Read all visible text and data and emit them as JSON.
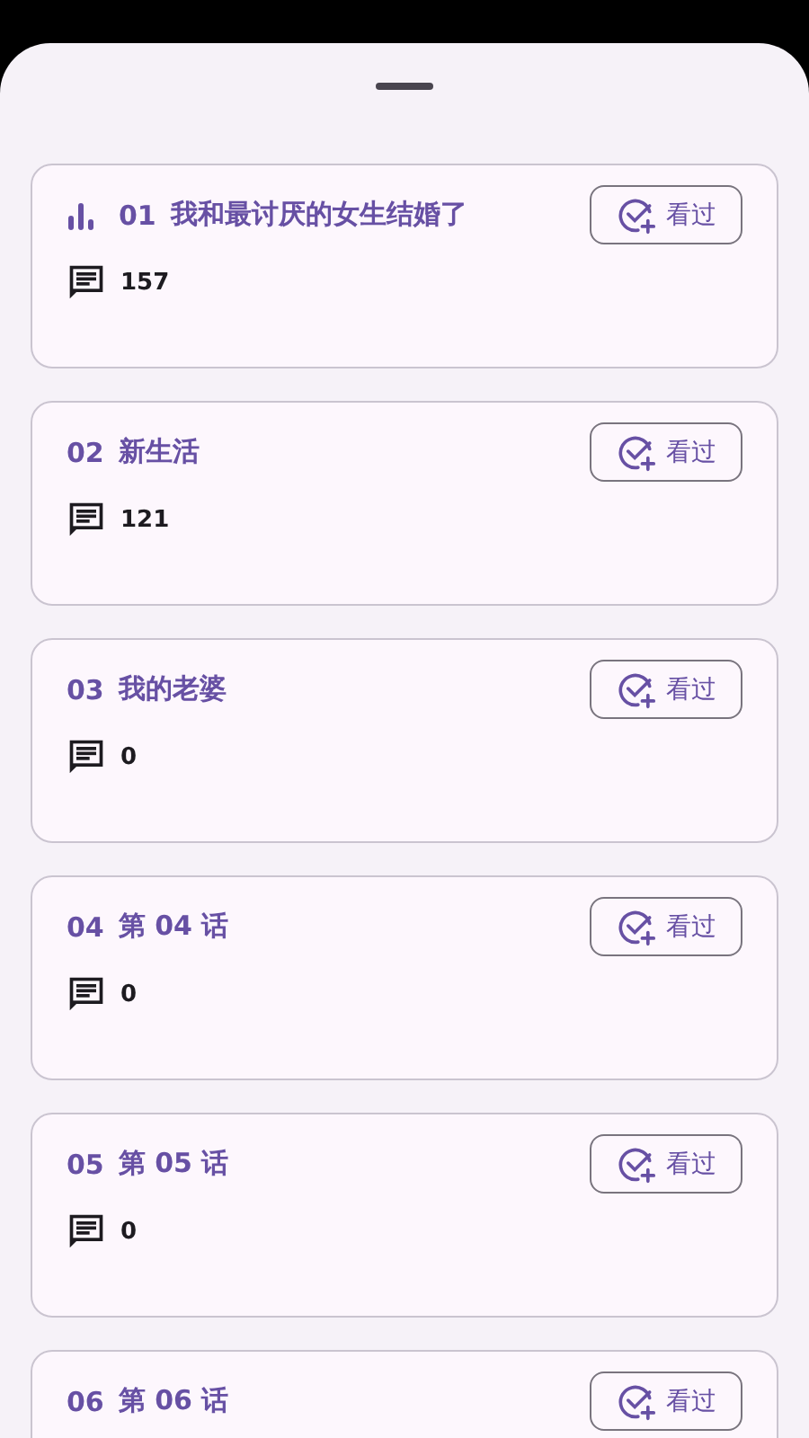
{
  "episodes": [
    {
      "number": "01",
      "title": "我和最讨厌的女生结婚了",
      "playing": true,
      "comments": "157",
      "button": "看过"
    },
    {
      "number": "02",
      "title": "新生活",
      "playing": false,
      "comments": "121",
      "button": "看过"
    },
    {
      "number": "03",
      "title": "我的老婆",
      "playing": false,
      "comments": "0",
      "button": "看过"
    },
    {
      "number": "04",
      "title": "第 04 话",
      "playing": false,
      "comments": "0",
      "button": "看过"
    },
    {
      "number": "05",
      "title": "第 05 话",
      "playing": false,
      "comments": "0",
      "button": "看过"
    },
    {
      "number": "06",
      "title": "第 06 话",
      "playing": false,
      "button": "看过"
    }
  ]
}
